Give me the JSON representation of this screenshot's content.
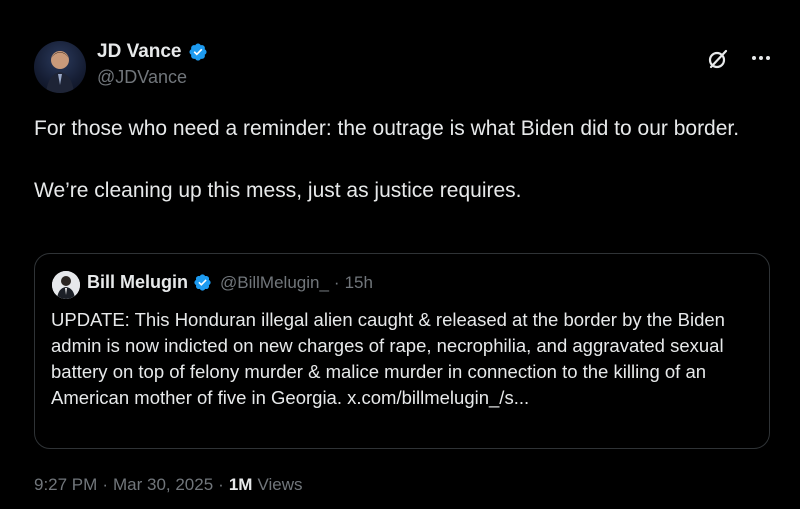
{
  "tweet": {
    "author_name": "JD Vance",
    "author_handle": "@JDVance",
    "text_lines": [
      "For those who need a reminder: the outrage is what Biden did to our border.",
      "We’re cleaning up this mess, just as justice requires."
    ],
    "time": "9:27 PM",
    "date": "Mar 30, 2025",
    "views_count": "1M",
    "views_label": "Views"
  },
  "quote": {
    "author_name": "Bill Melugin",
    "author_handle": "@BillMelugin_",
    "separator": "·",
    "time_ago": "15h",
    "text": "UPDATE: This Honduran illegal alien caught & released at the border by the Biden admin is now indicted on new charges of rape, necrophilia, and aggravated sexual battery on top of felony murder & malice murder in connection to the killing of an American mother of five in Georgia. x.com/billmelugin_/s..."
  },
  "meta": {
    "separator": "·"
  },
  "colors": {
    "background": "#000000",
    "text": "#e7e9ea",
    "muted": "#71767b",
    "border": "#2f3336",
    "verified": "#1d9bf0"
  },
  "icons": [
    "verified-badge-icon",
    "grok-icon",
    "more-options-icon"
  ]
}
